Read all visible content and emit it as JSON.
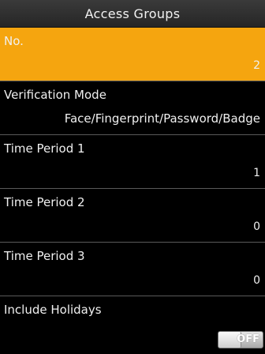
{
  "title": "Access Groups",
  "items": [
    {
      "label": "No.",
      "value": "2",
      "selected": true
    },
    {
      "label": "Verification Mode",
      "value": "Face/Fingerprint/Password/Badge"
    },
    {
      "label": "Time Period 1",
      "value": "1"
    },
    {
      "label": "Time Period 2",
      "value": "0"
    },
    {
      "label": "Time Period 3",
      "value": "0"
    },
    {
      "label": "Include Holidays",
      "toggle": "OFF"
    }
  ],
  "colors": {
    "selected_bg": "#f5a50f",
    "background": "#000000"
  }
}
